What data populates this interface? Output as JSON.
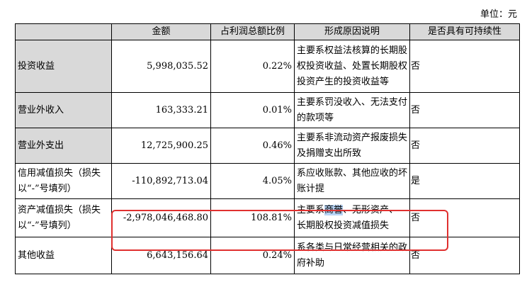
{
  "unit_label": "单位：元",
  "headers": [
    "",
    "金额",
    "占利润总额比例",
    "形成原因说明",
    "是否具有可持续性"
  ],
  "rows": [
    {
      "item": "投资收益",
      "amount": "5,998,035.52",
      "ratio": "0.22%",
      "reason": "主要系权益法核算的长期股权投资收益、处置长期股权投资产生的投资收益等",
      "sustainable": "否"
    },
    {
      "item": "营业外收入",
      "amount": "163,333.21",
      "ratio": "0.01%",
      "reason": "主要系罚没收入、无法支付的款项等",
      "sustainable": "否"
    },
    {
      "item": "营业外支出",
      "amount": "12,725,900.25",
      "ratio": "0.46%",
      "reason": "主要系非流动资产报废损失及捐赠支出所致",
      "sustainable": "否"
    },
    {
      "item": "信用减值损失（损失以“-”号填列）",
      "amount": "-110,892,713.04",
      "ratio": "4.05%",
      "reason": "系应收账款、其他应收的坏账计提",
      "sustainable": "是"
    },
    {
      "item": "资产减值损失（损失以“-”号填列）",
      "amount": "-2,978,046,468.80",
      "ratio": "108.81%",
      "reason_before": "主要系",
      "reason_selected": "商誉",
      "reason_after": "、无形资产、长期股权投资减值损失",
      "sustainable": "否"
    },
    {
      "item": "其他收益",
      "amount": "6,643,156.64",
      "ratio": "0.24%",
      "reason": "系各类与日常经营相关的政府补助",
      "sustainable": "否"
    }
  ]
}
